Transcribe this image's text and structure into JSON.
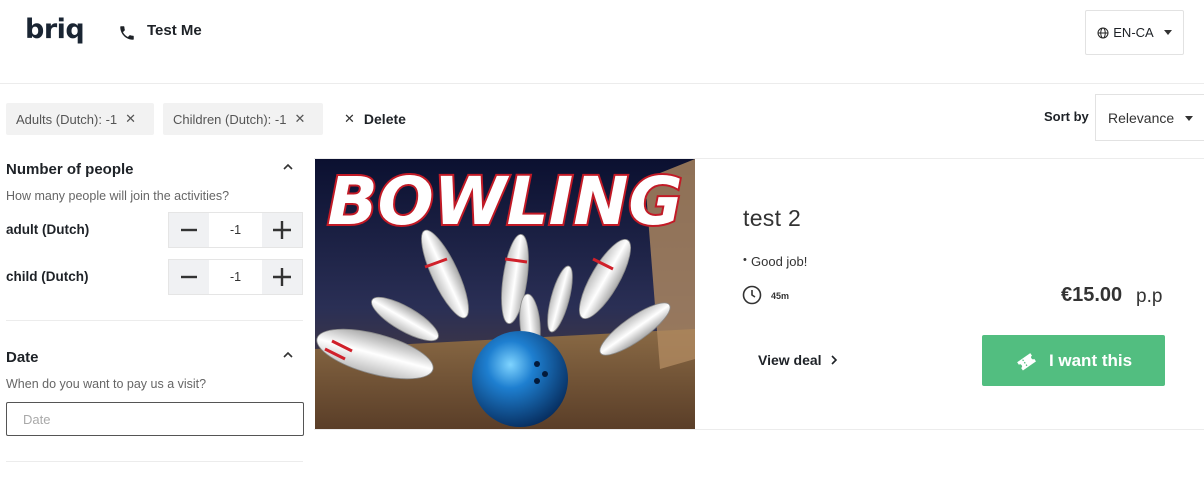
{
  "header": {
    "logo": "briq",
    "phone_label": "Test Me",
    "language": "EN-CA"
  },
  "filters_bar": {
    "chips": [
      {
        "label": "Adults (Dutch): -1"
      },
      {
        "label": "Children (Dutch): -1"
      }
    ],
    "delete_label": "Delete",
    "sort_label": "Sort by",
    "sort_value": "Relevance"
  },
  "sidebar": {
    "people": {
      "title": "Number of people",
      "subtitle": "How many people will join the activities?",
      "rows": [
        {
          "label": "adult (Dutch)",
          "value": "-1"
        },
        {
          "label": "child (Dutch)",
          "value": "-1"
        }
      ]
    },
    "date": {
      "title": "Date",
      "subtitle": "When do you want to pay us a visit?",
      "placeholder": "Date"
    }
  },
  "card": {
    "image_text": "BOWLING",
    "title": "test 2",
    "bullets": [
      "Good job!"
    ],
    "duration": "45m",
    "price": "€15.00",
    "price_unit": "p.p",
    "view_deal": "View deal",
    "cta": "I want this"
  },
  "colors": {
    "accent_green": "#52be80",
    "logo_navy": "#1a2533"
  }
}
